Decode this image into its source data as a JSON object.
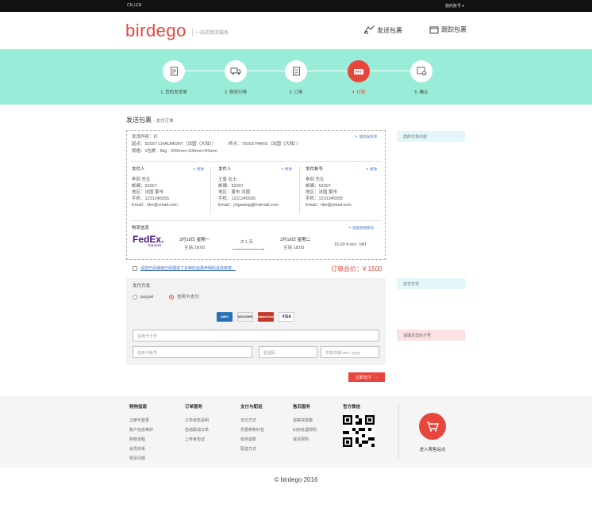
{
  "topbar": {
    "lang": "CN | EN",
    "account": "我的账号 ▾"
  },
  "header": {
    "logo": "birdego",
    "tagline": "一站式物流服务",
    "nav_send": "发送包裹",
    "nav_track": "跟踪包裹"
  },
  "steps": [
    {
      "label": "1. 您的发货单",
      "icon": "order-form-icon"
    },
    {
      "label": "2. 物流行情",
      "icon": "truck-icon"
    },
    {
      "label": "3. 订单",
      "icon": "order-list-icon"
    },
    {
      "label": "4. 付款",
      "icon": "pay-icon",
      "badge": "PAY"
    },
    {
      "label": "5. 确认",
      "icon": "confirm-icon"
    }
  ],
  "page": {
    "title": "发送包裹",
    "subtitle": "- 支付订单"
  },
  "order": {
    "content_line": "发货内容：衫",
    "edit_order": "修改发货单",
    "from_line": "起点：52007 CHAUMONT（法国（大陆））",
    "to_line": "终点：75003 PARIS（法国（大陆））",
    "pkg_line": "规格：1包裹  ·  5kg  ·  200mm×100mm×50mm",
    "sender": {
      "title": "发件人",
      "edit": "修改",
      "lines": [
        "李四 先生",
        "邮编：52007",
        "地区：法国 蒙市",
        "手机：1231245555",
        "Email：like@ymail.com"
      ]
    },
    "receiver": {
      "title": "发件人",
      "edit": "修改",
      "lines": [
        "王晋 女士",
        "邮编：52007",
        "地区：蒙市 法国",
        "手机：1231245555",
        "Email：jingwang@hotmail.com"
      ]
    },
    "bill": {
      "title": "发件帐号",
      "edit": "修改",
      "lines": [
        "李四 先生",
        "邮编：52007",
        "地区：法国 蒙市",
        "手机：1231245555",
        "Email：like@ymail.com"
      ]
    },
    "logistics_title": "物流信息",
    "logistics_change": "选择其他物流",
    "carrier_main": "FedEx.",
    "carrier_sub": "Express",
    "depart_date": "3月18日 星期一",
    "depart_time": "主站 18:00",
    "duration": "1 天",
    "arrive_date": "3月18日 星期二",
    "arrive_time": "主站 18:00",
    "price": "15.00 ¥ incl. VAT"
  },
  "agree_text": "请您已阅读我已经描述了多种的运费声明的具体条款。",
  "total": "订单总价：¥ 1500",
  "payment": {
    "title": "支付方式",
    "opt_paypal": "paypal",
    "opt_card": "信用卡支付",
    "cards": [
      {
        "name": "AMEX",
        "color": "#2a6fb3"
      },
      {
        "name": "DISCOVER",
        "color": "#f2f2f2"
      },
      {
        "name": "MasterCard",
        "color": "#c0392b"
      },
      {
        "name": "VISA",
        "color": "#fff"
      }
    ],
    "ph_card_number": "信用卡卡号",
    "ph_card_holder": "信用卡帐号",
    "ph_cvv": "验证码",
    "ph_expiry": "失效日期 mm / yyyy",
    "submit": "立即支付"
  },
  "side": {
    "order_content": "您的订单内容",
    "pay_method": "支付方式",
    "card_hint": "请填写您的卡号"
  },
  "footer": {
    "cols": [
      {
        "title": "购物指南",
        "items": [
          "注册与登录",
          "账户信息维护",
          "购物流程",
          "会员体系",
          "常见问题"
        ]
      },
      {
        "title": "订单服务",
        "items": [
          "订单状态说明",
          "自动取消订单",
          "上传身份证"
        ]
      },
      {
        "title": "支付与配送",
        "items": [
          "支付方式",
          "优惠券和红包",
          "如何退款",
          "配送方式"
        ]
      },
      {
        "title": "售后服务",
        "items": [
          "退换货政策",
          "纠纷处理规则",
          "退货规则"
        ]
      },
      {
        "title": "官方微信",
        "items": []
      }
    ],
    "store_label": "进入零售站点",
    "copyright": "© birdego 2016"
  },
  "colors": {
    "accent": "#e8453c",
    "band": "#99ecd8",
    "side_blue": "#e3f7fb",
    "side_pink": "#fbe1e1"
  }
}
